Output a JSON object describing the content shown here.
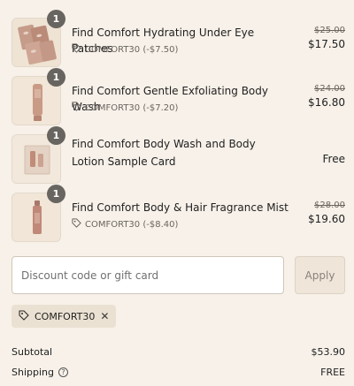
{
  "items": [
    {
      "name": "Find Comfort Hydrating Under Eye Patches",
      "quantity": "1",
      "discount": "COMFORT30 (-$7.50)",
      "original_price": "$25.00",
      "price": "$17.50",
      "thumbnail_icon": "under-eye-patches-thumbnail"
    },
    {
      "name": "Find Comfort Gentle Exfoliating Body Wash",
      "quantity": "1",
      "discount": "COMFORT30 (-$7.20)",
      "original_price": "$24.00",
      "price": "$16.80",
      "thumbnail_icon": "body-wash-tube-thumbnail"
    },
    {
      "name": "Find Comfort Body Wash and Body Lotion Sample Card",
      "quantity": "1",
      "price": "Free",
      "thumbnail_icon": "sample-card-thumbnail"
    },
    {
      "name": "Find Comfort Body & Hair Fragrance Mist",
      "quantity": "1",
      "discount": "COMFORT30 (-$8.40)",
      "original_price": "$28.00",
      "price": "$19.60",
      "thumbnail_icon": "fragrance-mist-bottle-thumbnail"
    }
  ],
  "discount_form": {
    "placeholder": "Discount code or gift card",
    "value": "",
    "apply_label": "Apply"
  },
  "applied_code": {
    "code": "COMFORT30",
    "icon": "tag-icon",
    "remove_icon": "close-icon"
  },
  "summary": {
    "subtotal_label": "Subtotal",
    "subtotal_value": "$53.90",
    "shipping_label": "Shipping",
    "shipping_value": "FREE",
    "shipping_help_icon": "help-circle-icon"
  },
  "colors": {
    "background": "#f7f1e9",
    "badge": "#686561",
    "muted_text": "#6b6560",
    "chip_background": "#ebe1d2",
    "apply_button_background": "#efe6d9"
  }
}
